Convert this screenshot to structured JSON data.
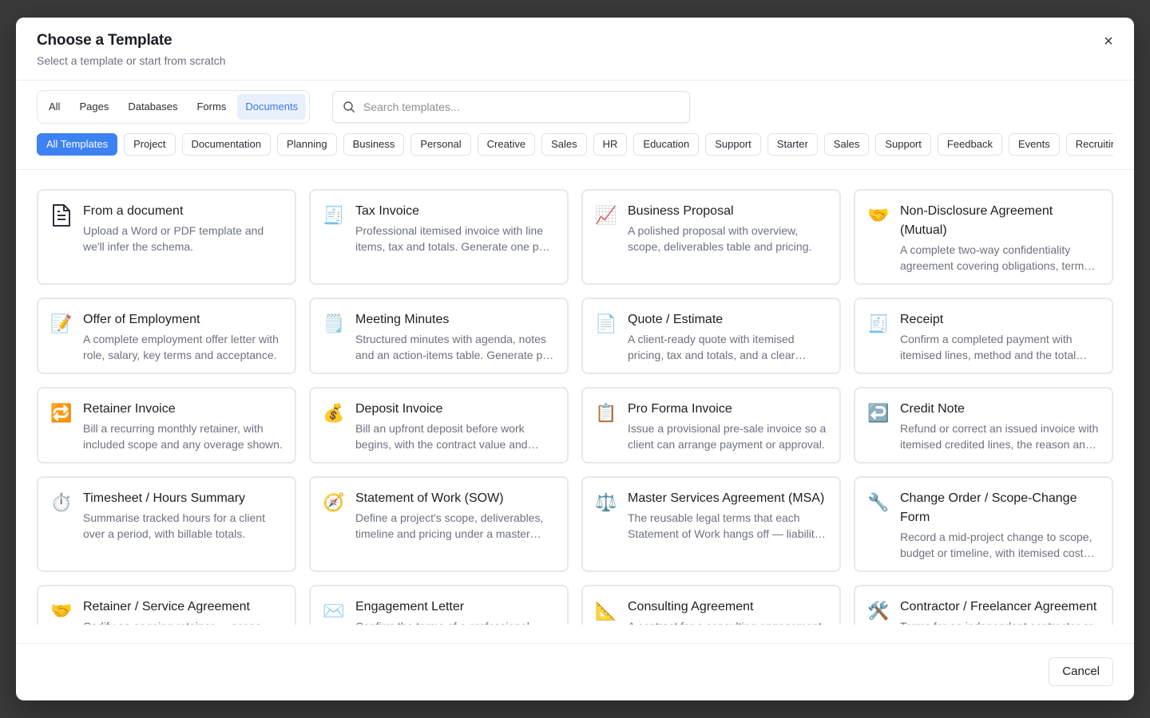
{
  "modal": {
    "title": "Choose a Template",
    "subtitle": "Select a template or start from scratch",
    "close_glyph": "×"
  },
  "type_tabs": [
    "All",
    "Pages",
    "Databases",
    "Forms",
    "Documents"
  ],
  "active_type_tab": "Documents",
  "search": {
    "placeholder": "Search templates...",
    "value": ""
  },
  "category_chips": [
    "All Templates",
    "Project",
    "Documentation",
    "Planning",
    "Business",
    "Personal",
    "Creative",
    "Sales",
    "HR",
    "Education",
    "Support",
    "Starter",
    "Sales",
    "Support",
    "Feedback",
    "Events",
    "Recruiting"
  ],
  "active_chip": "All Templates",
  "templates": [
    {
      "icon": "document-icon",
      "glyph": "doc",
      "title": "From a document",
      "desc": "Upload a Word or PDF template and we'll infer the schema."
    },
    {
      "icon": "receipt-icon",
      "glyph": "🧾",
      "title": "Tax Invoice",
      "desc": "Professional itemised invoice with line items, tax and totals. Generate one per record."
    },
    {
      "icon": "chart-increasing-icon",
      "glyph": "📈",
      "title": "Business Proposal",
      "desc": "A polished proposal with overview, scope, deliverables table and pricing."
    },
    {
      "icon": "handshake-icon",
      "glyph": "🤝",
      "title": "Non-Disclosure Agreement (Mutual)",
      "desc": "A complete two-way confidentiality agreement covering obligations, term and exclusions."
    },
    {
      "icon": "memo-icon",
      "glyph": "📝",
      "title": "Offer of Employment",
      "desc": "A complete employment offer letter with role, salary, key terms and acceptance."
    },
    {
      "icon": "notepad-icon",
      "glyph": "🗒️",
      "title": "Meeting Minutes",
      "desc": "Structured minutes with agenda, notes and an action-items table. Generate per meeting."
    },
    {
      "icon": "page-icon",
      "glyph": "📄",
      "title": "Quote / Estimate",
      "desc": "A client-ready quote with itemised pricing, tax and totals, and a clear validity date."
    },
    {
      "icon": "receipt-icon",
      "glyph": "🧾",
      "title": "Receipt",
      "desc": "Confirm a completed payment with itemised lines, method and the total paid."
    },
    {
      "icon": "repeat-icon",
      "glyph": "🔁",
      "title": "Retainer Invoice",
      "desc": "Bill a recurring monthly retainer, with included scope and any overage shown."
    },
    {
      "icon": "money-bag-icon",
      "glyph": "💰",
      "title": "Deposit Invoice",
      "desc": "Bill an upfront deposit before work begins, with the contract value and balance due."
    },
    {
      "icon": "clipboard-icon",
      "glyph": "📋",
      "title": "Pro Forma Invoice",
      "desc": "Issue a provisional pre-sale invoice so a client can arrange payment or approval."
    },
    {
      "icon": "return-arrow-icon",
      "glyph": "↩️",
      "title": "Credit Note",
      "desc": "Refund or correct an issued invoice with itemised credited lines, the reason and total."
    },
    {
      "icon": "stopwatch-icon",
      "glyph": "⏱️",
      "title": "Timesheet / Hours Summary",
      "desc": "Summarise tracked hours for a client over a period, with billable totals."
    },
    {
      "icon": "compass-icon",
      "glyph": "🧭",
      "title": "Statement of Work (SOW)",
      "desc": "Define a project's scope, deliverables, timeline and pricing under a master agreement."
    },
    {
      "icon": "scales-icon",
      "glyph": "⚖️",
      "title": "Master Services Agreement (MSA)",
      "desc": "The reusable legal terms that each Statement of Work hangs off — liability, IP and more."
    },
    {
      "icon": "wrench-icon",
      "glyph": "🔧",
      "title": "Change Order / Scope-Change Form",
      "desc": "Record a mid-project change to scope, budget or timeline, with itemised cost impact."
    },
    {
      "icon": "handshake-icon",
      "glyph": "🤝",
      "title": "Retainer / Service Agreement",
      "desc": "Codify an ongoing retainer — scope, hours, fees and terms."
    },
    {
      "icon": "envelope-icon",
      "glyph": "✉️",
      "title": "Engagement Letter",
      "desc": "Confirm the terms of a professional engagement with a client."
    },
    {
      "icon": "triangular-ruler-icon",
      "glyph": "📐",
      "title": "Consulting Agreement",
      "desc": "A contract for a consulting engagement."
    },
    {
      "icon": "hammer-and-wrench-icon",
      "glyph": "🛠️",
      "title": "Contractor / Freelancer Agreement",
      "desc": "Terms for an independent contractor or freelancer."
    }
  ],
  "footer": {
    "cancel_label": "Cancel"
  },
  "colors": {
    "accent": "#3d82f3",
    "active_tab_bg": "#e8f0fd",
    "active_tab_text": "#3c78e6"
  }
}
